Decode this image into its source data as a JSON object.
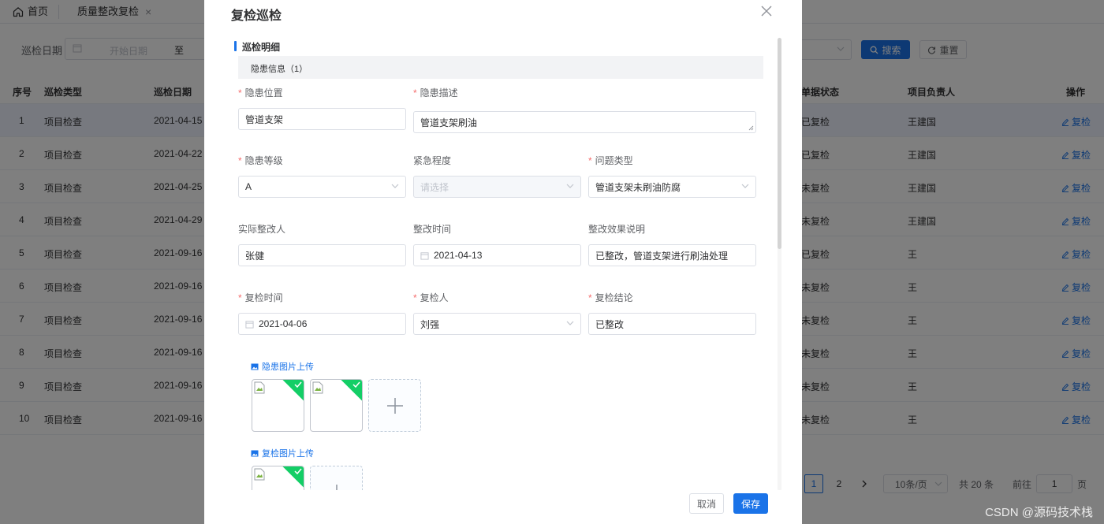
{
  "tabs": [
    {
      "label": "首页",
      "icon": "home-icon"
    },
    {
      "label": "质量整改复检",
      "icon": "close-icon"
    }
  ],
  "filter": {
    "date_label": "巡检日期",
    "start_placeholder": "开始日期",
    "range_separator": "至",
    "search_label": "搜索",
    "reset_label": "重置"
  },
  "table": {
    "headers": [
      "序号",
      "巡检类型",
      "巡检日期",
      "单据状态",
      "项目负责人",
      "操作"
    ],
    "rows": [
      {
        "no": "1",
        "type": "项目检查",
        "date": "2021-04-15",
        "status": "已复检",
        "owner": "王建国",
        "op": "复检"
      },
      {
        "no": "2",
        "type": "项目检查",
        "date": "2021-04-22",
        "status": "已复检",
        "owner": "王建国",
        "op": "复检"
      },
      {
        "no": "3",
        "type": "项目检查",
        "date": "2021-04-25",
        "status": "未复检",
        "owner": "王建国",
        "op": "复检"
      },
      {
        "no": "4",
        "type": "项目检查",
        "date": "2021-04-29",
        "status": "未复检",
        "owner": "王建国",
        "op": "复检"
      },
      {
        "no": "5",
        "type": "项目检查",
        "date": "2021-09-16",
        "status": "已复检",
        "owner": "王",
        "op": "复检"
      },
      {
        "no": "6",
        "type": "项目检查",
        "date": "2021-09-16",
        "status": "未复检",
        "owner": "王",
        "op": "复检"
      },
      {
        "no": "7",
        "type": "项目检查",
        "date": "2021-09-16",
        "status": "未复检",
        "owner": "王",
        "op": "复检"
      },
      {
        "no": "8",
        "type": "项目检查",
        "date": "2021-09-16",
        "status": "未复检",
        "owner": "王",
        "op": "复检"
      },
      {
        "no": "9",
        "type": "项目检查",
        "date": "2021-09-16",
        "status": "未复检",
        "owner": "王",
        "op": "复检"
      },
      {
        "no": "10",
        "type": "项目检查",
        "date": "2021-09-16",
        "status": "未复检",
        "owner": "王",
        "op": "复检"
      }
    ]
  },
  "pagination": {
    "pages": [
      "1",
      "2"
    ],
    "current": "1",
    "page_size": "10条/页",
    "total": "共 20 条",
    "goto_label": "前往",
    "goto_value": "1",
    "page_unit": "页"
  },
  "dialog": {
    "title": "复检巡检",
    "section_title": "巡检明细",
    "sub_header": "隐患信息（1）",
    "fields": {
      "hazard_location": {
        "label": "隐患位置",
        "value": "管道支架"
      },
      "hazard_desc": {
        "label": "隐患描述",
        "value": "管道支架刷油"
      },
      "hazard_level": {
        "label": "隐患等级",
        "value": "A"
      },
      "urgency": {
        "label": "紧急程度",
        "placeholder": "请选择"
      },
      "problem_type": {
        "label": "问题类型",
        "value": "管道支架未刷油防腐"
      },
      "actual_rectifier": {
        "label": "实际整改人",
        "value": "张健"
      },
      "rectify_time": {
        "label": "整改时间",
        "value": "2021-04-13"
      },
      "rectify_effect": {
        "label": "整改效果说明",
        "value": "已整改，管道支架进行刷油处理"
      },
      "recheck_time": {
        "label": "复检时间",
        "value": "2021-04-06"
      },
      "rechecker": {
        "label": "复检人",
        "value": "刘强"
      },
      "recheck_result": {
        "label": "复检结论",
        "value": "已整改"
      }
    },
    "hazard_upload_label": "隐患图片上传",
    "recheck_upload_label": "复检图片上传",
    "cancel_label": "取消",
    "save_label": "保存"
  },
  "watermark": "CSDN @源码技术栈",
  "colors": {
    "primary": "#1a73e8",
    "required": "#f56c6c",
    "success": "#13ce66",
    "selected_row": "#eef3fe"
  }
}
